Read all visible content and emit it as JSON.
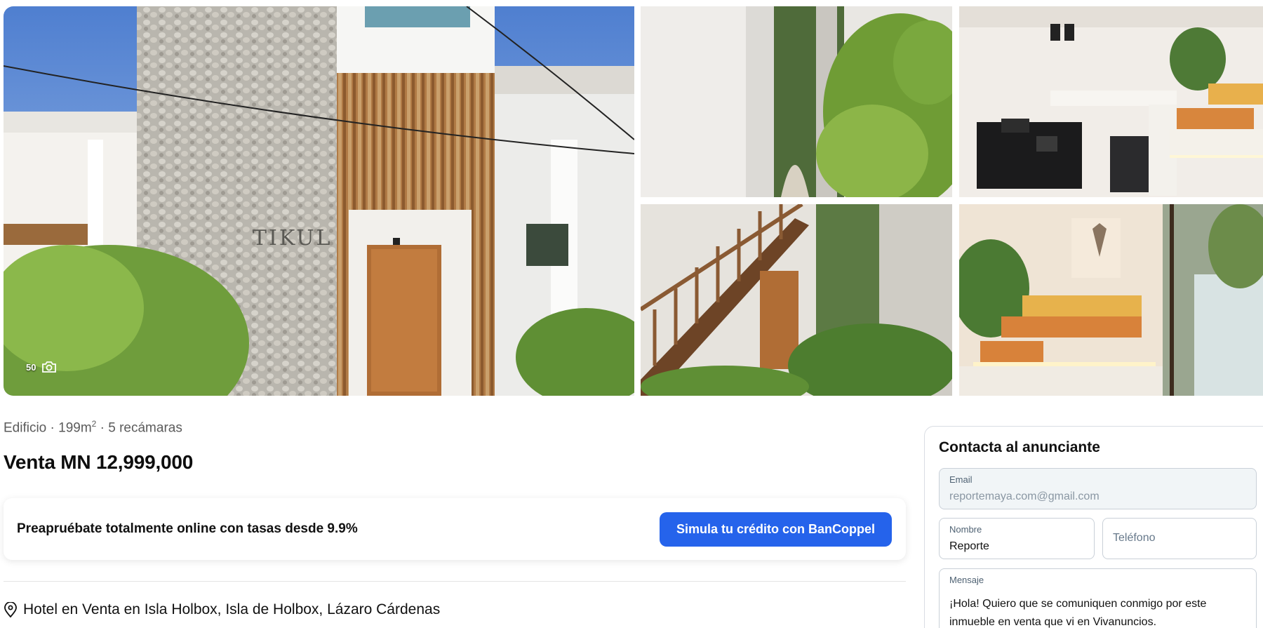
{
  "gallery": {
    "photo_count": "50",
    "photos": [
      {
        "name": "main-building-facade"
      },
      {
        "name": "garden-wall"
      },
      {
        "name": "room-safe-desk"
      },
      {
        "name": "wooden-stairs"
      },
      {
        "name": "room-lounge-bed"
      }
    ]
  },
  "listing": {
    "subtitle_prefix": "Edificio · 199m",
    "subtitle_sup": "2",
    "subtitle_suffix": " · 5 recámaras",
    "price": "Venta MN 12,999,000",
    "address": "Hotel en Venta en Isla Holbox, Isla de Holbox, Lázaro Cárdenas"
  },
  "promo": {
    "text": "Preapruébate totalmente online con tasas desde 9.9%",
    "button_label": "Simula tu crédito con BanCoppel"
  },
  "contact": {
    "title": "Contacta al anunciante",
    "email_label": "Email",
    "email_value": "reportemaya.com@gmail.com",
    "name_label": "Nombre",
    "name_value": "Reporte",
    "phone_placeholder": "Teléfono",
    "message_label": "Mensaje",
    "message_value": "¡Hola! Quiero que se comuniquen conmigo por este inmueble en venta que vi en Vivanuncios."
  },
  "colors": {
    "accent": "#2563eb"
  }
}
